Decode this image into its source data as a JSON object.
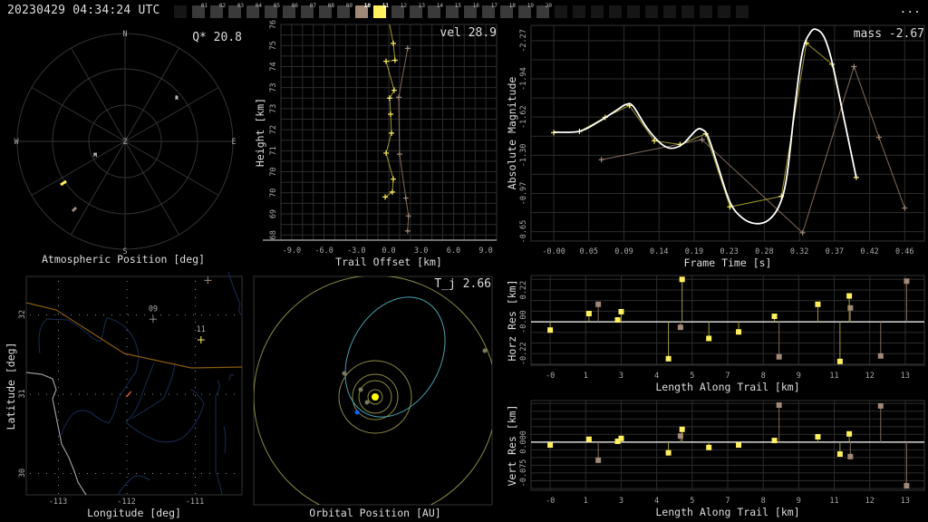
{
  "header": {
    "timestamp": "20230429 04:34:24 UTC",
    "more_label": "...",
    "stations": [
      {
        "label": "",
        "state": "blank"
      },
      {
        "label": "01",
        "state": "off"
      },
      {
        "label": "02",
        "state": "off"
      },
      {
        "label": "03",
        "state": "off"
      },
      {
        "label": "04",
        "state": "off"
      },
      {
        "label": "05",
        "state": "off"
      },
      {
        "label": "06",
        "state": "off"
      },
      {
        "label": "07",
        "state": "off"
      },
      {
        "label": "08",
        "state": "off"
      },
      {
        "label": "09",
        "state": "off"
      },
      {
        "label": "10",
        "state": "selected",
        "color": "#a08878"
      },
      {
        "label": "11",
        "state": "selected",
        "color": "#fff060"
      },
      {
        "label": "12",
        "state": "off"
      },
      {
        "label": "13",
        "state": "off"
      },
      {
        "label": "14",
        "state": "off"
      },
      {
        "label": "15",
        "state": "off"
      },
      {
        "label": "16",
        "state": "off"
      },
      {
        "label": "17",
        "state": "off"
      },
      {
        "label": "18",
        "state": "off"
      },
      {
        "label": "19",
        "state": "off"
      },
      {
        "label": "20",
        "state": "off"
      },
      {
        "label": "",
        "state": "blank"
      },
      {
        "label": "",
        "state": "blank"
      },
      {
        "label": "",
        "state": "blank"
      },
      {
        "label": "",
        "state": "blank"
      },
      {
        "label": "",
        "state": "blank"
      },
      {
        "label": "",
        "state": "blank"
      },
      {
        "label": "",
        "state": "blank"
      },
      {
        "label": "",
        "state": "blank"
      },
      {
        "label": "",
        "state": "blank"
      },
      {
        "label": "",
        "state": "blank"
      },
      {
        "label": "",
        "state": "blank"
      }
    ]
  },
  "colors": {
    "station_a": "#fff060",
    "station_b": "#a08878",
    "fit": "#ffffff",
    "grid": "#2c2c2c",
    "orbit": "#8a8a40",
    "meteor_orbit": "#4aa0b0",
    "earth": "#1060ff",
    "sun": "#ffff00"
  },
  "atmospheric": {
    "title": "Atmospheric Position [deg]",
    "annotation": "Q* 20.8",
    "north": "N",
    "south": "S",
    "east": "E",
    "west": "W",
    "zenith": "Z",
    "marker_m": "M",
    "marker_r": "R"
  },
  "chart_data": [
    {
      "type": "line",
      "name": "height-vs-offset",
      "xlabel": "Trail Offset [km]",
      "ylabel": "Height [km]",
      "annotation": "vel 28.9",
      "xlim": [
        -10,
        10
      ],
      "ylim": [
        68.0,
        76.2
      ],
      "x_ticks": [
        -9,
        -6,
        -3,
        0,
        3,
        6,
        9
      ],
      "x_tick_labels": [
        "-9.0",
        "-6.0",
        "-3.0",
        "0.0",
        "3.0",
        "6.0",
        "9.0"
      ],
      "y_ticks": [
        76.2,
        75.4,
        74.6,
        73.8,
        73.0,
        72.2,
        71.4,
        70.6,
        69.8,
        69.0,
        68.2
      ],
      "y_tick_labels": [
        "76",
        "75",
        "74",
        "73",
        "73",
        "72",
        "71",
        "70",
        "70",
        "69",
        "68"
      ],
      "series": [
        {
          "name": "10",
          "color": "#a08878",
          "x": [
            1.75,
            0.92,
            1.0,
            1.58,
            1.83,
            1.75
          ],
          "y": [
            75.29,
            73.43,
            71.27,
            69.6,
            68.92,
            68.35
          ]
        },
        {
          "name": "11",
          "color": "#fff060",
          "x": [
            0.0,
            0.42,
            0.58,
            -0.25,
            0.5,
            0.08,
            0.17,
            0.25,
            -0.25,
            0.42,
            0.33,
            -0.33
          ],
          "y": [
            76.35,
            75.48,
            74.84,
            74.8,
            73.7,
            73.4,
            72.79,
            72.07,
            71.31,
            70.32,
            69.83,
            69.64
          ]
        }
      ]
    },
    {
      "type": "line",
      "name": "magnitude-vs-time",
      "xlabel": "Frame Time [s]",
      "ylabel": "Absolute Magnitude",
      "annotation": "mass -2.67",
      "xlim": [
        -0.03,
        0.49
      ],
      "ylim": [
        -0.57,
        -2.4
      ],
      "x_ticks": [
        0,
        0.0464,
        0.0928,
        0.1392,
        0.1856,
        0.232,
        0.2784,
        0.3248,
        0.3712,
        0.4176,
        0.464
      ],
      "x_tick_labels": [
        "-0.00",
        "0.05",
        "0.09",
        "0.14",
        "0.19",
        "0.23",
        "0.28",
        "0.32",
        "0.37",
        "0.42",
        "0.46"
      ],
      "y_ticks": [
        -2.27,
        -1.946,
        -1.622,
        -1.298,
        -0.974,
        -0.65
      ],
      "y_tick_labels": [
        "-2.27",
        "-1.94",
        "-1.62",
        "-1.30",
        "-0.97",
        "-0.65"
      ],
      "series": [
        {
          "name": "10",
          "color": "#a08878",
          "x": [
            0.063,
            0.196,
            0.329,
            0.397,
            0.43,
            0.464
          ],
          "y": [
            -1.26,
            -1.43,
            -0.64,
            -2.05,
            -1.45,
            -0.85
          ]
        },
        {
          "name": "11",
          "color": "#fff060",
          "x": [
            0,
            0.034,
            0.068,
            0.1,
            0.133,
            0.167,
            0.201,
            0.233,
            0.301,
            0.334,
            0.368,
            0.4
          ],
          "y": [
            -1.49,
            -1.5,
            -1.62,
            -1.72,
            -1.42,
            -1.39,
            -1.48,
            -0.86,
            -0.95,
            -2.25,
            -2.07,
            -1.11
          ]
        },
        {
          "name": "fit",
          "color": "#ffffff",
          "x": [
            0,
            0.034,
            0.06,
            0.084,
            0.096,
            0.105,
            0.123,
            0.142,
            0.156,
            0.171,
            0.188,
            0.196,
            0.204,
            0.216,
            0.233,
            0.25,
            0.268,
            0.284,
            0.298,
            0.308,
            0.319,
            0.329,
            0.34,
            0.349,
            0.358,
            0.368,
            0.385,
            0.4
          ],
          "y": [
            -1.494,
            -1.501,
            -1.585,
            -1.684,
            -1.73,
            -1.714,
            -1.532,
            -1.395,
            -1.357,
            -1.395,
            -1.509,
            -1.517,
            -1.456,
            -1.227,
            -0.9,
            -0.763,
            -0.718,
            -0.748,
            -0.87,
            -1.113,
            -1.722,
            -2.179,
            -2.346,
            -2.361,
            -2.293,
            -2.087,
            -1.57,
            -1.106
          ]
        }
      ]
    },
    {
      "type": "scatter",
      "name": "horizontal-residuals",
      "xlabel": "Length Along Trail [km]",
      "ylabel": "Horz Res [km]",
      "xlim": [
        -0.7,
        13.7
      ],
      "ylim": [
        -0.3,
        0.32
      ],
      "x_ticks": [
        0,
        1.3,
        2.6,
        3.9,
        5.2,
        6.5,
        7.8,
        9.1,
        10.4,
        11.7,
        13.0
      ],
      "x_tick_labels": [
        "-0",
        "1",
        "3",
        "4",
        "5",
        "7",
        "8",
        "9",
        "11",
        "12",
        "13"
      ],
      "y_ticks": [
        0.22,
        0,
        -0.22
      ],
      "y_tick_labels": [
        "0.22",
        "-0.00",
        "-0.22"
      ],
      "series": [
        {
          "name": "10",
          "color": "#a08878",
          "x": [
            1.76,
            4.77,
            8.38,
            10.99,
            12.1,
            13.05
          ],
          "y": [
            0.121,
            -0.038,
            -0.242,
            0.096,
            -0.236,
            0.281
          ]
        },
        {
          "name": "11",
          "color": "#fff060",
          "x": [
            0,
            1.42,
            2.47,
            2.6,
            4.33,
            4.83,
            5.81,
            6.9,
            8.21,
            9.8,
            10.61,
            10.95
          ],
          "y": [
            -0.057,
            0.057,
            0.013,
            0.07,
            -0.255,
            0.293,
            -0.115,
            -0.07,
            0.038,
            0.121,
            -0.274,
            0.179
          ]
        }
      ]
    },
    {
      "type": "scatter",
      "name": "vertical-residuals",
      "xlabel": "Length Along Trail [km]",
      "ylabel": "Vert Res [km]",
      "xlim": [
        -0.7,
        13.7
      ],
      "ylim": [
        -0.117,
        0.101
      ],
      "x_ticks": [
        0,
        1.3,
        2.6,
        3.9,
        5.2,
        6.5,
        7.8,
        9.1,
        10.4,
        11.7,
        13.0
      ],
      "x_tick_labels": [
        "-0",
        "1",
        "3",
        "4",
        "5",
        "7",
        "8",
        "9",
        "11",
        "12",
        "13"
      ],
      "y_ticks": [
        0,
        -0.075
      ],
      "y_tick_labels": [
        "0.000",
        "-0.075"
      ],
      "series": [
        {
          "name": "10",
          "color": "#a08878",
          "x": [
            1.76,
            4.77,
            8.38,
            10.99,
            12.1,
            13.05
          ],
          "y": [
            -0.044,
            0.015,
            0.09,
            -0.035,
            0.088,
            -0.106
          ]
        },
        {
          "name": "11",
          "color": "#fff060",
          "x": [
            0,
            1.42,
            2.47,
            2.6,
            4.33,
            4.83,
            5.81,
            6.9,
            8.21,
            9.8,
            10.61,
            10.95
          ],
          "y": [
            -0.007,
            0.007,
            0.002,
            0.009,
            -0.026,
            0.031,
            -0.013,
            -0.007,
            0.004,
            0.013,
            -0.029,
            0.02
          ]
        }
      ]
    }
  ],
  "map": {
    "xlabel": "Longitude [deg]",
    "ylabel": "Latitude [deg]",
    "x_tick_labels": [
      "-113",
      "-112",
      "-111"
    ],
    "y_tick_labels": [
      "32",
      "31",
      "30"
    ],
    "stations": [
      {
        "label": "09",
        "lon": -111.61,
        "lat": 31.94,
        "color": "#888888"
      },
      {
        "label": "11",
        "lon": -110.91,
        "lat": 31.68,
        "color": "#fff060"
      },
      {
        "label": "",
        "lon": -110.81,
        "lat": 32.43,
        "color": "#a08878"
      }
    ],
    "trail": {
      "lon": [
        -112.0,
        -111.93
      ],
      "lat": [
        30.96,
        31.03
      ]
    }
  },
  "orbital": {
    "title": "Orbital Position [AU]",
    "annotation": "T_j 2.66"
  }
}
